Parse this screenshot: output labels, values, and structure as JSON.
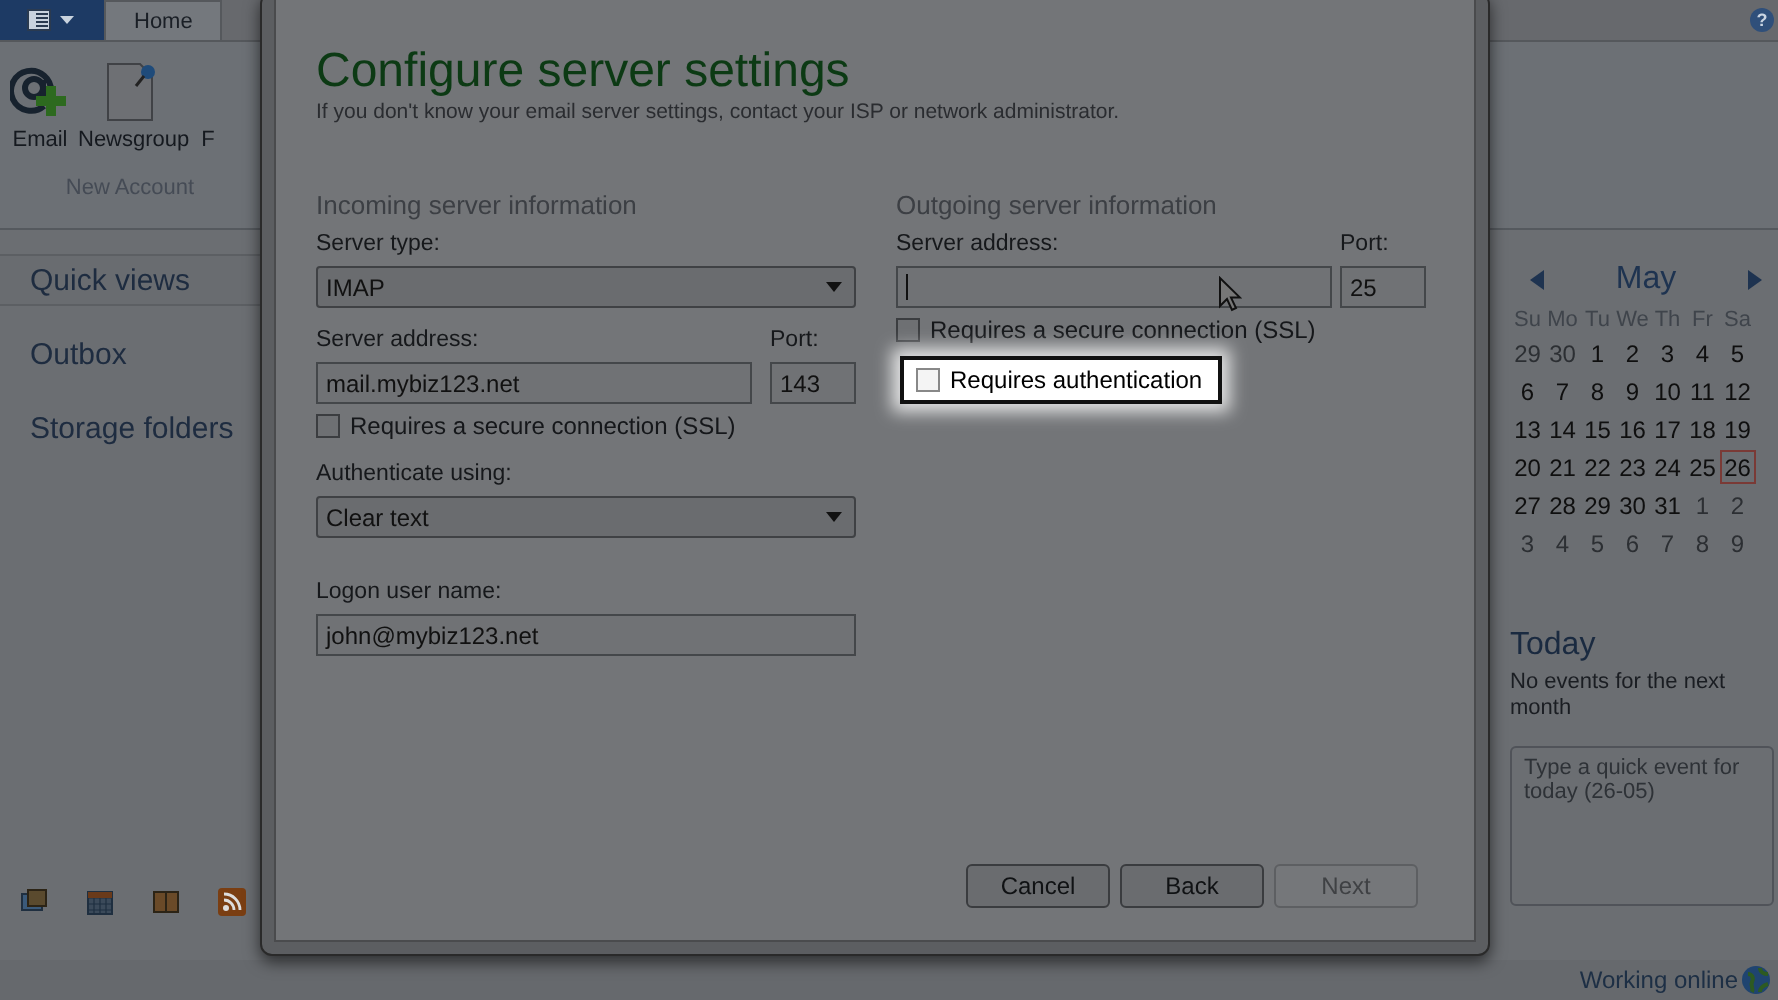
{
  "help_label": "?",
  "ribbon": {
    "tabs": [
      {
        "label": "Home",
        "selected": true
      }
    ],
    "buttons": [
      {
        "label": "Email",
        "kind": "email"
      },
      {
        "label": "Newsgroup",
        "kind": "newsgroup"
      },
      {
        "label": "F",
        "kind": "cut"
      }
    ],
    "group_label": "New Account"
  },
  "nav": {
    "items": [
      {
        "label": "Quick views",
        "selected": true
      },
      {
        "label": "Outbox",
        "selected": false
      },
      {
        "label": "Storage folders",
        "selected": false
      }
    ]
  },
  "dialog": {
    "title": "Configure server settings",
    "subtitle": "If you don't know your email server settings, contact your ISP or network administrator.",
    "incoming": {
      "heading": "Incoming server information",
      "server_type_label": "Server type:",
      "server_type": "IMAP",
      "address_label": "Server address:",
      "address": "mail.mybiz123.net",
      "port_label": "Port:",
      "port": "143",
      "ssl": {
        "label": "Requires a secure connection (SSL)",
        "checked": false
      },
      "auth_label": "Authenticate using:",
      "auth": "Clear text",
      "user_label": "Logon user name:",
      "user": "john@mybiz123.net"
    },
    "outgoing": {
      "heading": "Outgoing server information",
      "address_label": "Server address:",
      "address_focused": true,
      "port_label": "Port:",
      "port": "25",
      "checkboxes": [
        {
          "label": "Requires a secure connection (SSL)",
          "checked": false,
          "highlighted": false
        },
        {
          "label": "Requires authentication",
          "checked": false,
          "highlighted": true
        }
      ]
    },
    "buttons": [
      {
        "label": "Cancel",
        "disabled": false
      },
      {
        "label": "Back",
        "disabled": false
      },
      {
        "label": "Next",
        "disabled": true
      }
    ]
  },
  "calendar": {
    "month": "May",
    "weekdays": [
      "Su",
      "Mo",
      "Tu",
      "We",
      "Th",
      "Fr",
      "Sa"
    ],
    "days": [
      {
        "text": "29",
        "muted": true,
        "selected": false
      },
      {
        "text": "30",
        "muted": true,
        "selected": false
      },
      {
        "text": "1",
        "muted": false,
        "selected": false
      },
      {
        "text": "2",
        "muted": false,
        "selected": false
      },
      {
        "text": "3",
        "muted": false,
        "selected": false
      },
      {
        "text": "4",
        "muted": false,
        "selected": false
      },
      {
        "text": "5",
        "muted": false,
        "selected": false
      },
      {
        "text": "6",
        "muted": false,
        "selected": false
      },
      {
        "text": "7",
        "muted": false,
        "selected": false
      },
      {
        "text": "8",
        "muted": false,
        "selected": false
      },
      {
        "text": "9",
        "muted": false,
        "selected": false
      },
      {
        "text": "10",
        "muted": false,
        "selected": false
      },
      {
        "text": "11",
        "muted": false,
        "selected": false
      },
      {
        "text": "12",
        "muted": false,
        "selected": false
      },
      {
        "text": "13",
        "muted": false,
        "selected": false
      },
      {
        "text": "14",
        "muted": false,
        "selected": false
      },
      {
        "text": "15",
        "muted": false,
        "selected": false
      },
      {
        "text": "16",
        "muted": false,
        "selected": false
      },
      {
        "text": "17",
        "muted": false,
        "selected": false
      },
      {
        "text": "18",
        "muted": false,
        "selected": false
      },
      {
        "text": "19",
        "muted": false,
        "selected": false
      },
      {
        "text": "20",
        "muted": false,
        "selected": false
      },
      {
        "text": "21",
        "muted": false,
        "selected": false
      },
      {
        "text": "22",
        "muted": false,
        "selected": false
      },
      {
        "text": "23",
        "muted": false,
        "selected": false
      },
      {
        "text": "24",
        "muted": false,
        "selected": false
      },
      {
        "text": "25",
        "muted": false,
        "selected": false
      },
      {
        "text": "26",
        "muted": false,
        "selected": true
      },
      {
        "text": "27",
        "muted": false,
        "selected": false
      },
      {
        "text": "28",
        "muted": false,
        "selected": false
      },
      {
        "text": "29",
        "muted": false,
        "selected": false
      },
      {
        "text": "30",
        "muted": false,
        "selected": false
      },
      {
        "text": "31",
        "muted": false,
        "selected": false
      },
      {
        "text": "1",
        "muted": true,
        "selected": false
      },
      {
        "text": "2",
        "muted": true,
        "selected": false
      },
      {
        "text": "3",
        "muted": true,
        "selected": false
      },
      {
        "text": "4",
        "muted": true,
        "selected": false
      },
      {
        "text": "5",
        "muted": true,
        "selected": false
      },
      {
        "text": "6",
        "muted": true,
        "selected": false
      },
      {
        "text": "7",
        "muted": true,
        "selected": false
      },
      {
        "text": "8",
        "muted": true,
        "selected": false
      },
      {
        "text": "9",
        "muted": true,
        "selected": false
      }
    ]
  },
  "today": {
    "title": "Today",
    "message": "No events for the next month",
    "placeholder": "Type a quick event for today (26-05)"
  },
  "status": "Working online"
}
